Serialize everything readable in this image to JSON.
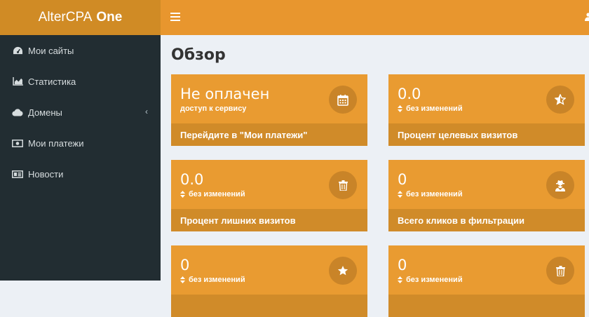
{
  "brand": {
    "name": "AlterCPA",
    "bold": "One"
  },
  "sidebar": {
    "items": [
      {
        "label": "Мои сайты",
        "icon": "dashboard-icon"
      },
      {
        "label": "Статистика",
        "icon": "area-chart-icon"
      },
      {
        "label": "Домены",
        "icon": "cloud-icon",
        "has_submenu": true
      },
      {
        "label": "Мои платежи",
        "icon": "money-icon"
      },
      {
        "label": "Новости",
        "icon": "newspaper-icon"
      }
    ]
  },
  "page": {
    "title": "Обзор"
  },
  "boxes": [
    {
      "value": "Не оплачен",
      "sub": "доступ к сервису",
      "footer": "Перейдите в \"Мои платежи\"",
      "icon": "calendar-icon"
    },
    {
      "value": "0.0",
      "sub": "без изменений",
      "footer": "Процент целевых визитов",
      "icon": "star-half-icon"
    },
    {
      "value": "0.0",
      "sub": "без изменений",
      "footer": "Процент лишних визитов",
      "icon": "trash-icon"
    },
    {
      "value": "0",
      "sub": "без изменений",
      "footer": "Всего кликов в фильтрации",
      "icon": "user-secret-icon"
    },
    {
      "value": "0",
      "sub": "без изменений",
      "footer": "",
      "icon": "star-icon"
    },
    {
      "value": "0",
      "sub": "без изменений",
      "footer": "",
      "icon": "trash-icon"
    }
  ],
  "colors": {
    "brand_header": "#d08b25",
    "topbar": "#e8962e",
    "sidebar": "#222d32",
    "box": "#e99b31",
    "box_footer": "#d08b29",
    "background": "#ecf0f5"
  }
}
